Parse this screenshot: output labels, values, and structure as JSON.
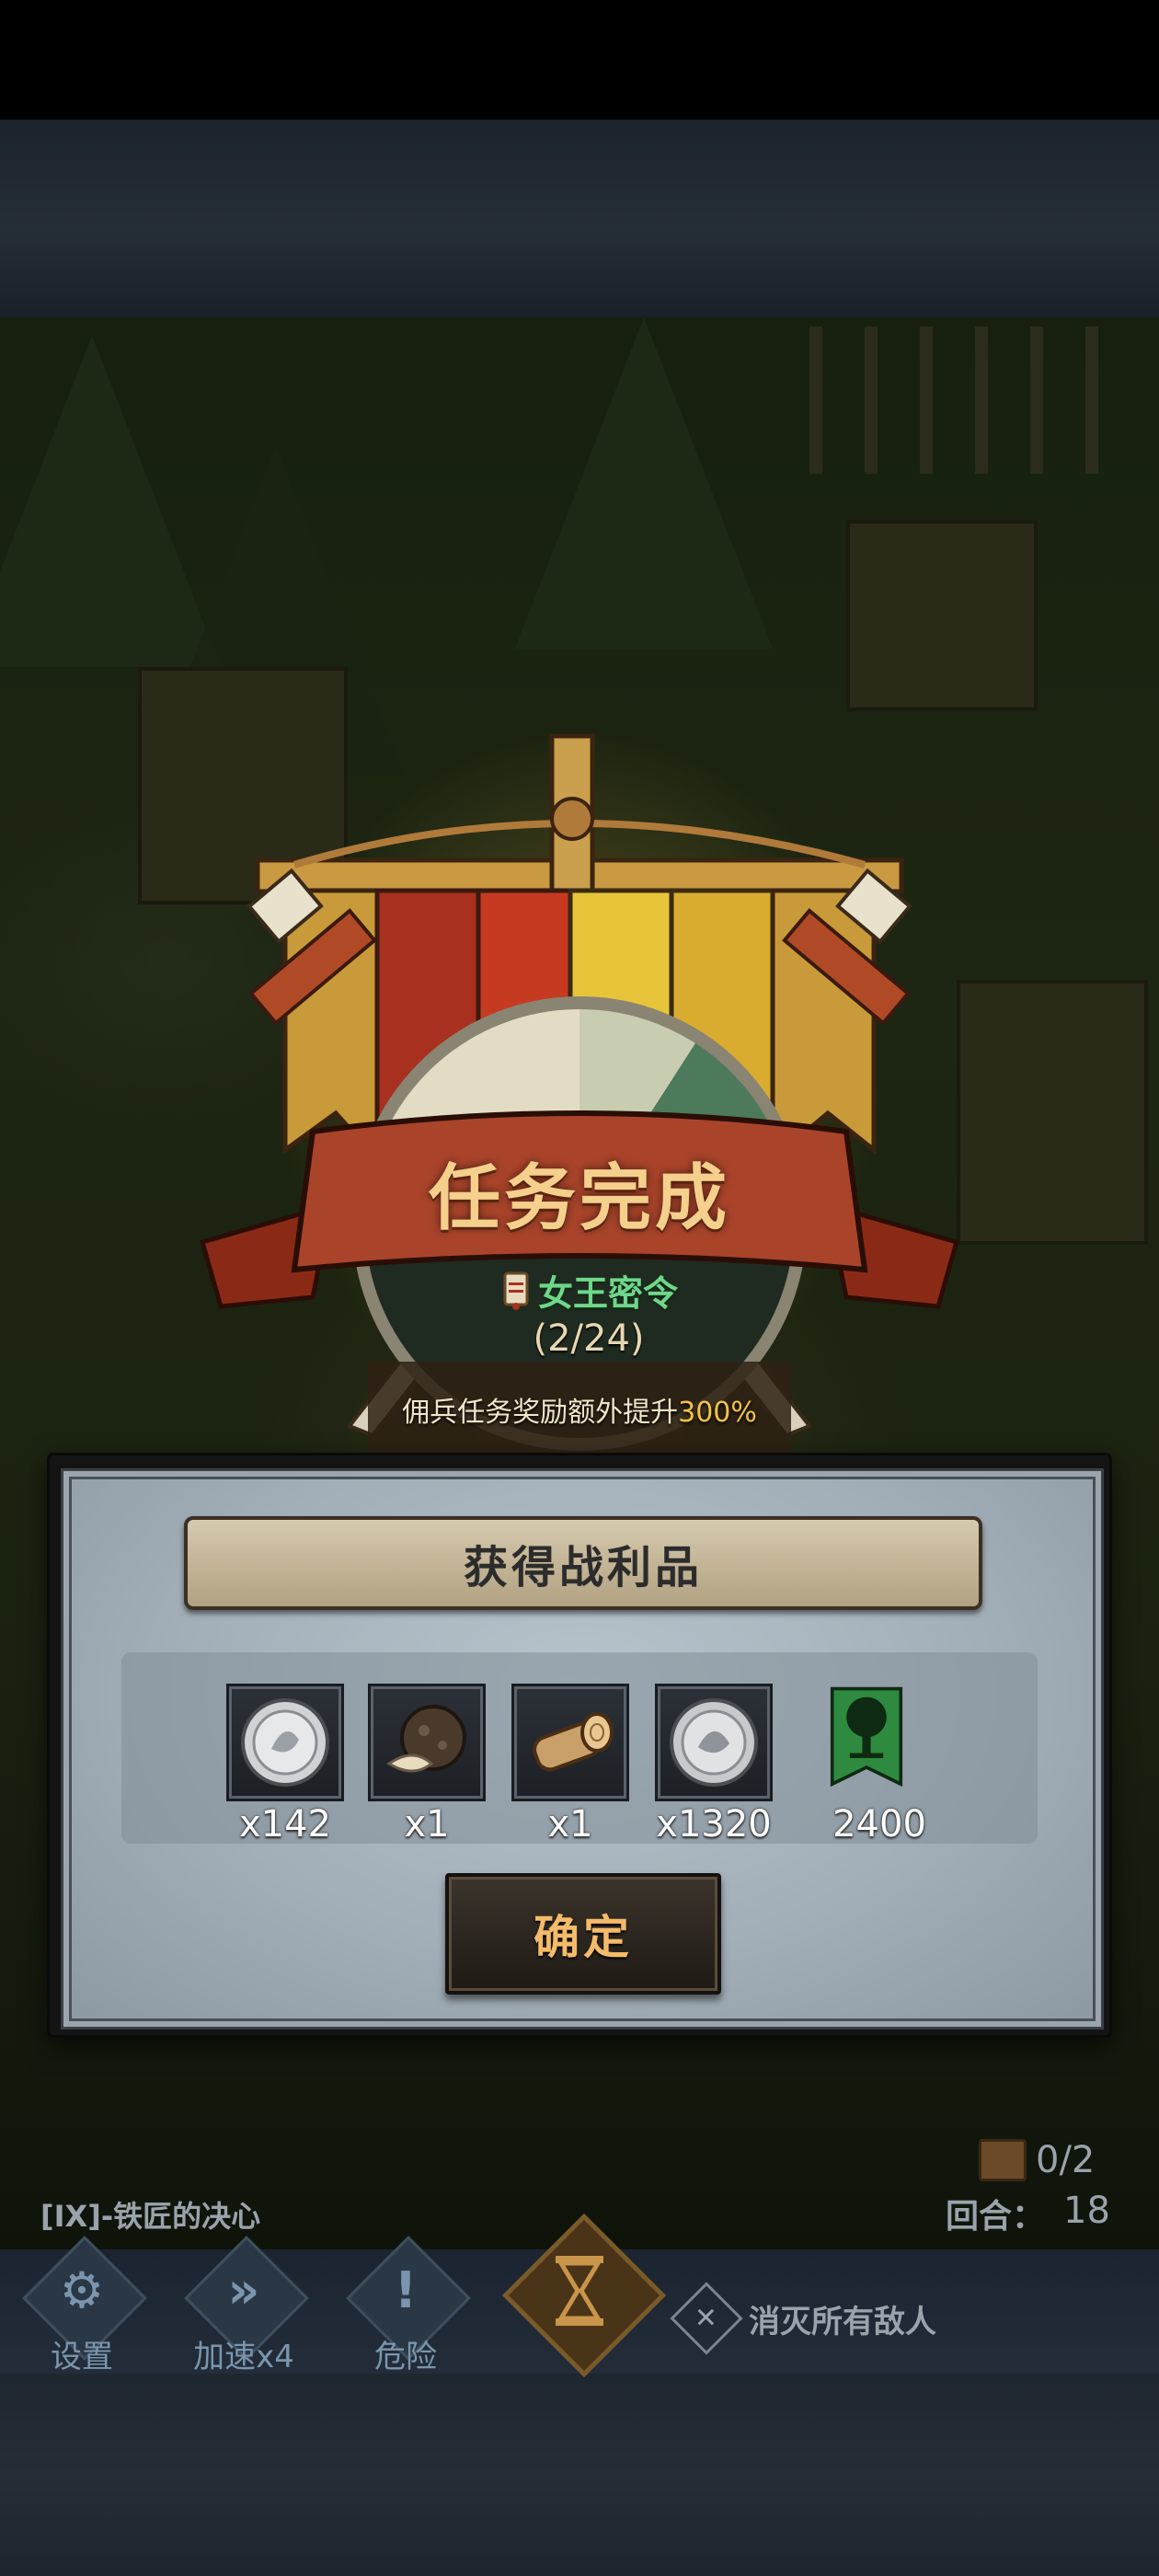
{
  "banner": {
    "title": "任务完成",
    "quest_name": "女王密令",
    "progress": "(2/24)",
    "bonus_text": "佣兵任务奖励额外提升",
    "bonus_percent": "300%"
  },
  "loot": {
    "title": "获得战利品",
    "items": [
      {
        "icon": "silver-coin-icon",
        "quantity": "x142"
      },
      {
        "icon": "truffle-icon",
        "quantity": "x1"
      },
      {
        "icon": "wood-log-icon",
        "quantity": "x1"
      },
      {
        "icon": "silver-coin-icon",
        "quantity": "x1320"
      },
      {
        "icon": "tree-banner-icon",
        "quantity": "2400"
      }
    ],
    "confirm_label": "确定"
  },
  "hud": {
    "chest_counter": "0/2",
    "level_title": "[IX]-铁匠的决心",
    "round_label": "回合：",
    "round_value": "18"
  },
  "toolbar": {
    "settings_label": "设置",
    "speed_label": "加速x4",
    "danger_label": "危险",
    "objective_text": "消灭所有敌人"
  },
  "colors": {
    "title_gold": "#f5cf8c",
    "quest_green": "#6fd68a",
    "confirm_orange": "#f4bb6a",
    "bonus_yellow": "#f2c24a"
  }
}
